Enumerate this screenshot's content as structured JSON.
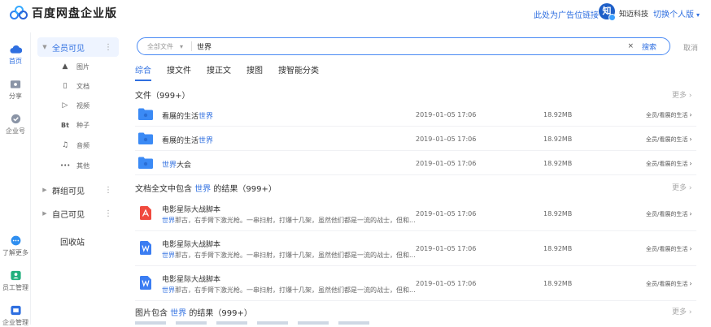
{
  "header": {
    "app_title": "百度网盘企业版",
    "ad_link": "此处为广告位链接",
    "avatar_text": "知",
    "org_name": "知迈科技",
    "switch_label": "切换个人版",
    "switch_caret": "▾"
  },
  "leftnav": {
    "items": [
      {
        "label": "首页",
        "icon": "cloud-icon"
      },
      {
        "label": "分享",
        "icon": "share-icon"
      },
      {
        "label": "企业号",
        "icon": "badge-icon"
      },
      {
        "label": "了解更多",
        "icon": "more-circle-icon"
      },
      {
        "label": "员工管理",
        "icon": "staff-icon"
      },
      {
        "label": "企业管理",
        "icon": "org-icon"
      }
    ]
  },
  "tree": {
    "all_visible": "全员可见",
    "leaves": [
      {
        "label": "图片",
        "icon": "▲"
      },
      {
        "label": "文档",
        "icon": "▯"
      },
      {
        "label": "视频",
        "icon": "▷"
      },
      {
        "label": "种子",
        "icon": "Bt"
      },
      {
        "label": "音频",
        "icon": "♫"
      },
      {
        "label": "其他",
        "icon": "•••"
      }
    ],
    "group_visible": "群组可见",
    "self_visible": "自己可见",
    "recycle": "回收站",
    "dots": "⋮"
  },
  "search": {
    "scope": "全部文件",
    "scope_caret": "▾",
    "query": "世界",
    "clear": "×",
    "button": "搜索",
    "cancel": "取消"
  },
  "tabs": [
    "综合",
    "搜文件",
    "搜正文",
    "搜图",
    "搜智能分类"
  ],
  "sections": {
    "files_title": "文件（999+）",
    "fulltext_prefix": "文档全文中包含",
    "fulltext_hl": "世界",
    "fulltext_suffix": "的结果（999+）",
    "images_prefix": "图片包含",
    "images_hl": "世界",
    "images_suffix": "的结果（999+）",
    "more": "更多 ›"
  },
  "file_rows": [
    {
      "name_prefix": "看展的生活",
      "name_hl": "世界",
      "name_suffix": "",
      "date": "2019–01–05 17:06",
      "size": "18.92MB",
      "path": "全员/看展的生活"
    },
    {
      "name_prefix": "看展的生活",
      "name_hl": "世界",
      "name_suffix": "",
      "date": "2019–01–05 17:06",
      "size": "18.92MB",
      "path": "全员/看展的生活"
    },
    {
      "name_prefix": "",
      "name_hl": "世界",
      "name_suffix": "大会",
      "date": "2019–01–05 17:06",
      "size": "18.92MB",
      "path": "全员/看展的生活"
    }
  ],
  "doc_rows": [
    {
      "type": "pdf",
      "name": "电影星际大战脚本",
      "snip_hl": "世界",
      "snip": "那古，右手臂下激光枪。一串扫射，打爆十几架，虽然他们都是一流的战士，但和...",
      "date": "2019–01–05 17:06",
      "size": "18.92MB",
      "path": "全员/看展的生活"
    },
    {
      "type": "word",
      "name": "电影星际大战脚本",
      "snip_hl": "世界",
      "snip": "那古，右手臂下激光枪。一串扫射，打爆十几架，虽然他们都是一流的战士，但和...",
      "date": "2019–01–05 17:06",
      "size": "18.92MB",
      "path": "全员/看展的生活"
    },
    {
      "type": "word",
      "name": "电影星际大战脚本",
      "snip_hl": "世界",
      "snip": "那古，右手臂下激光枪。一串扫射，打爆十几架，虽然他们都是一流的战士，但和...",
      "date": "2019–01–05 17:06",
      "size": "18.92MB",
      "path": "全员/看展的生活"
    }
  ],
  "colors": {
    "accent": "#2f6fe0",
    "folder": "#3b8af5",
    "pdf": "#f04a3e",
    "word": "#3b7df2"
  }
}
